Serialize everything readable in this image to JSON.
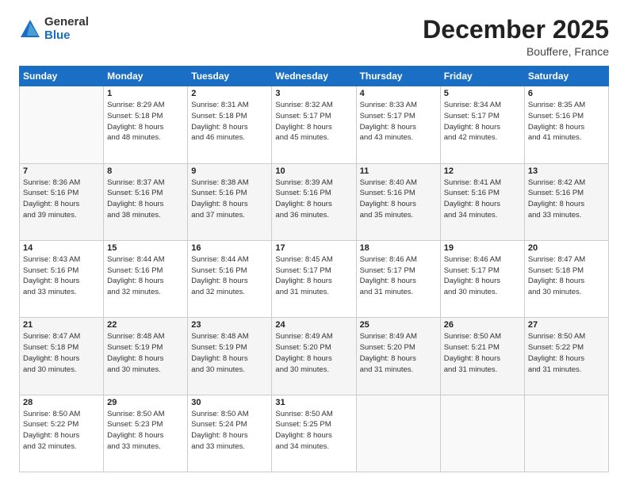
{
  "logo": {
    "general": "General",
    "blue": "Blue"
  },
  "title": "December 2025",
  "subtitle": "Bouffere, France",
  "days_header": [
    "Sunday",
    "Monday",
    "Tuesday",
    "Wednesday",
    "Thursday",
    "Friday",
    "Saturday"
  ],
  "weeks": [
    [
      {
        "num": "",
        "info": ""
      },
      {
        "num": "1",
        "info": "Sunrise: 8:29 AM\nSunset: 5:18 PM\nDaylight: 8 hours\nand 48 minutes."
      },
      {
        "num": "2",
        "info": "Sunrise: 8:31 AM\nSunset: 5:18 PM\nDaylight: 8 hours\nand 46 minutes."
      },
      {
        "num": "3",
        "info": "Sunrise: 8:32 AM\nSunset: 5:17 PM\nDaylight: 8 hours\nand 45 minutes."
      },
      {
        "num": "4",
        "info": "Sunrise: 8:33 AM\nSunset: 5:17 PM\nDaylight: 8 hours\nand 43 minutes."
      },
      {
        "num": "5",
        "info": "Sunrise: 8:34 AM\nSunset: 5:17 PM\nDaylight: 8 hours\nand 42 minutes."
      },
      {
        "num": "6",
        "info": "Sunrise: 8:35 AM\nSunset: 5:16 PM\nDaylight: 8 hours\nand 41 minutes."
      }
    ],
    [
      {
        "num": "7",
        "info": "Sunrise: 8:36 AM\nSunset: 5:16 PM\nDaylight: 8 hours\nand 39 minutes."
      },
      {
        "num": "8",
        "info": "Sunrise: 8:37 AM\nSunset: 5:16 PM\nDaylight: 8 hours\nand 38 minutes."
      },
      {
        "num": "9",
        "info": "Sunrise: 8:38 AM\nSunset: 5:16 PM\nDaylight: 8 hours\nand 37 minutes."
      },
      {
        "num": "10",
        "info": "Sunrise: 8:39 AM\nSunset: 5:16 PM\nDaylight: 8 hours\nand 36 minutes."
      },
      {
        "num": "11",
        "info": "Sunrise: 8:40 AM\nSunset: 5:16 PM\nDaylight: 8 hours\nand 35 minutes."
      },
      {
        "num": "12",
        "info": "Sunrise: 8:41 AM\nSunset: 5:16 PM\nDaylight: 8 hours\nand 34 minutes."
      },
      {
        "num": "13",
        "info": "Sunrise: 8:42 AM\nSunset: 5:16 PM\nDaylight: 8 hours\nand 33 minutes."
      }
    ],
    [
      {
        "num": "14",
        "info": "Sunrise: 8:43 AM\nSunset: 5:16 PM\nDaylight: 8 hours\nand 33 minutes."
      },
      {
        "num": "15",
        "info": "Sunrise: 8:44 AM\nSunset: 5:16 PM\nDaylight: 8 hours\nand 32 minutes."
      },
      {
        "num": "16",
        "info": "Sunrise: 8:44 AM\nSunset: 5:16 PM\nDaylight: 8 hours\nand 32 minutes."
      },
      {
        "num": "17",
        "info": "Sunrise: 8:45 AM\nSunset: 5:17 PM\nDaylight: 8 hours\nand 31 minutes."
      },
      {
        "num": "18",
        "info": "Sunrise: 8:46 AM\nSunset: 5:17 PM\nDaylight: 8 hours\nand 31 minutes."
      },
      {
        "num": "19",
        "info": "Sunrise: 8:46 AM\nSunset: 5:17 PM\nDaylight: 8 hours\nand 30 minutes."
      },
      {
        "num": "20",
        "info": "Sunrise: 8:47 AM\nSunset: 5:18 PM\nDaylight: 8 hours\nand 30 minutes."
      }
    ],
    [
      {
        "num": "21",
        "info": "Sunrise: 8:47 AM\nSunset: 5:18 PM\nDaylight: 8 hours\nand 30 minutes."
      },
      {
        "num": "22",
        "info": "Sunrise: 8:48 AM\nSunset: 5:19 PM\nDaylight: 8 hours\nand 30 minutes."
      },
      {
        "num": "23",
        "info": "Sunrise: 8:48 AM\nSunset: 5:19 PM\nDaylight: 8 hours\nand 30 minutes."
      },
      {
        "num": "24",
        "info": "Sunrise: 8:49 AM\nSunset: 5:20 PM\nDaylight: 8 hours\nand 30 minutes."
      },
      {
        "num": "25",
        "info": "Sunrise: 8:49 AM\nSunset: 5:20 PM\nDaylight: 8 hours\nand 31 minutes."
      },
      {
        "num": "26",
        "info": "Sunrise: 8:50 AM\nSunset: 5:21 PM\nDaylight: 8 hours\nand 31 minutes."
      },
      {
        "num": "27",
        "info": "Sunrise: 8:50 AM\nSunset: 5:22 PM\nDaylight: 8 hours\nand 31 minutes."
      }
    ],
    [
      {
        "num": "28",
        "info": "Sunrise: 8:50 AM\nSunset: 5:22 PM\nDaylight: 8 hours\nand 32 minutes."
      },
      {
        "num": "29",
        "info": "Sunrise: 8:50 AM\nSunset: 5:23 PM\nDaylight: 8 hours\nand 33 minutes."
      },
      {
        "num": "30",
        "info": "Sunrise: 8:50 AM\nSunset: 5:24 PM\nDaylight: 8 hours\nand 33 minutes."
      },
      {
        "num": "31",
        "info": "Sunrise: 8:50 AM\nSunset: 5:25 PM\nDaylight: 8 hours\nand 34 minutes."
      },
      {
        "num": "",
        "info": ""
      },
      {
        "num": "",
        "info": ""
      },
      {
        "num": "",
        "info": ""
      }
    ]
  ]
}
